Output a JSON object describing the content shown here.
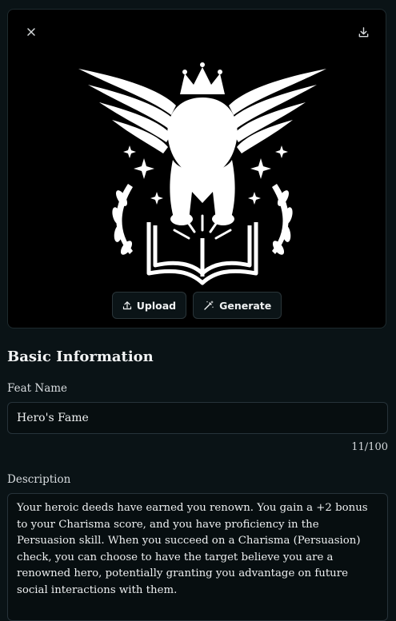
{
  "image_panel": {
    "close_icon": "close-icon",
    "download_icon": "download-icon",
    "emblem_description_icon": "winged-lion-emblem-icon",
    "upload_label": "Upload",
    "generate_label": "Generate"
  },
  "basic_info": {
    "title": "Basic Information",
    "feat_name_label": "Feat Name",
    "feat_name_value": "Hero's Fame",
    "feat_name_count": "11/100",
    "description_label": "Description",
    "description_value": "Your heroic deeds have earned you renown. You gain a +2 bonus to your Charisma score, and you have proficiency in the Persuasion skill. When you succeed on a Charisma (Persuasion) check, you can choose to have the target believe you are a renowned hero, potentially granting you advantage on future social interactions with them."
  },
  "colors": {
    "background": "#0a1316",
    "image_background": "#000000",
    "emblem": "#ffffff",
    "border": "#27333a"
  }
}
